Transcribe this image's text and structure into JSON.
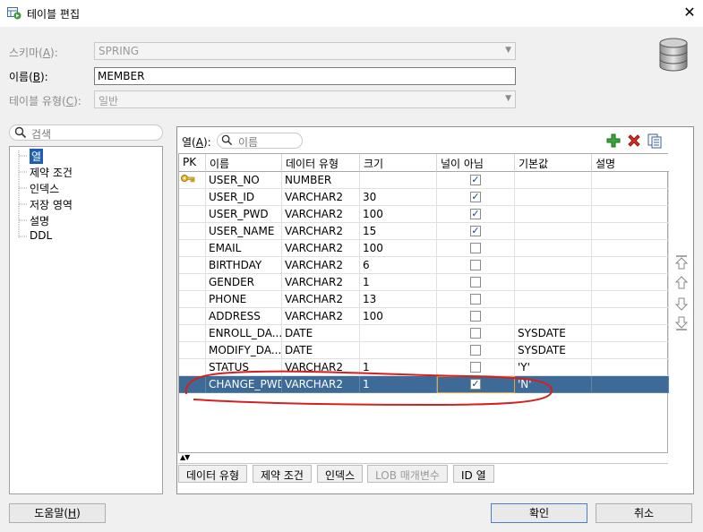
{
  "window": {
    "title": "테이블 편집",
    "close": "✕"
  },
  "fields": {
    "schema": {
      "label_pre": "스키마(",
      "mnemonic": "A",
      "label_post": "):",
      "value": "SPRING"
    },
    "name": {
      "label_pre": "이름(",
      "mnemonic": "B",
      "label_post": "):",
      "value": "MEMBER"
    },
    "table_type": {
      "label_pre": "테이블 유형(",
      "mnemonic": "C",
      "label_post": "):",
      "value": "일반"
    }
  },
  "left": {
    "search_placeholder": "검색",
    "items": [
      "열",
      "제약 조건",
      "인덱스",
      "저장 영역",
      "설명",
      "DDL"
    ]
  },
  "columns_panel": {
    "label_pre": "열(",
    "mnemonic": "A",
    "label_post": "):",
    "search_placeholder": "이름",
    "headers": [
      "PK",
      "이름",
      "데이터 유형",
      "크기",
      "널이 아님",
      "기본값",
      "설명"
    ],
    "rows": [
      {
        "pk": true,
        "name": "USER_NO",
        "type": "NUMBER",
        "size": "",
        "notnull": true,
        "default": "",
        "desc": ""
      },
      {
        "pk": false,
        "name": "USER_ID",
        "type": "VARCHAR2",
        "size": "30",
        "notnull": true,
        "default": "",
        "desc": ""
      },
      {
        "pk": false,
        "name": "USER_PWD",
        "type": "VARCHAR2",
        "size": "100",
        "notnull": true,
        "default": "",
        "desc": ""
      },
      {
        "pk": false,
        "name": "USER_NAME",
        "type": "VARCHAR2",
        "size": "15",
        "notnull": true,
        "default": "",
        "desc": ""
      },
      {
        "pk": false,
        "name": "EMAIL",
        "type": "VARCHAR2",
        "size": "100",
        "notnull": false,
        "default": "",
        "desc": ""
      },
      {
        "pk": false,
        "name": "BIRTHDAY",
        "type": "VARCHAR2",
        "size": "6",
        "notnull": false,
        "default": "",
        "desc": ""
      },
      {
        "pk": false,
        "name": "GENDER",
        "type": "VARCHAR2",
        "size": "1",
        "notnull": false,
        "default": "",
        "desc": ""
      },
      {
        "pk": false,
        "name": "PHONE",
        "type": "VARCHAR2",
        "size": "13",
        "notnull": false,
        "default": "",
        "desc": ""
      },
      {
        "pk": false,
        "name": "ADDRESS",
        "type": "VARCHAR2",
        "size": "100",
        "notnull": false,
        "default": "",
        "desc": ""
      },
      {
        "pk": false,
        "name": "ENROLL_DA...",
        "type": "DATE",
        "size": "",
        "notnull": false,
        "default": "SYSDATE",
        "desc": ""
      },
      {
        "pk": false,
        "name": "MODIFY_DA...",
        "type": "DATE",
        "size": "",
        "notnull": false,
        "default": "SYSDATE",
        "desc": ""
      },
      {
        "pk": false,
        "name": "STATUS",
        "type": "VARCHAR2",
        "size": "1",
        "notnull": false,
        "default": "'Y'",
        "desc": ""
      },
      {
        "pk": false,
        "name": "CHANGE_PWD",
        "type": "VARCHAR2",
        "size": "1",
        "notnull": true,
        "default": "'N'",
        "desc": "",
        "selected": true
      }
    ],
    "subtabs": [
      {
        "label": "데이터 유형",
        "enabled": true
      },
      {
        "label": "제약 조건",
        "enabled": true
      },
      {
        "label": "인덱스",
        "enabled": true
      },
      {
        "label": "LOB 매개변수",
        "enabled": false
      },
      {
        "label": "ID 열",
        "enabled": true
      }
    ]
  },
  "buttons": {
    "help_pre": "도움말(",
    "help_mnemonic": "H",
    "help_post": ")",
    "ok": "확인",
    "cancel": "취소"
  },
  "colors": {
    "selection": "#3d6a96",
    "tree_selection": "#1f5fb3",
    "annotation": "#d42020"
  }
}
